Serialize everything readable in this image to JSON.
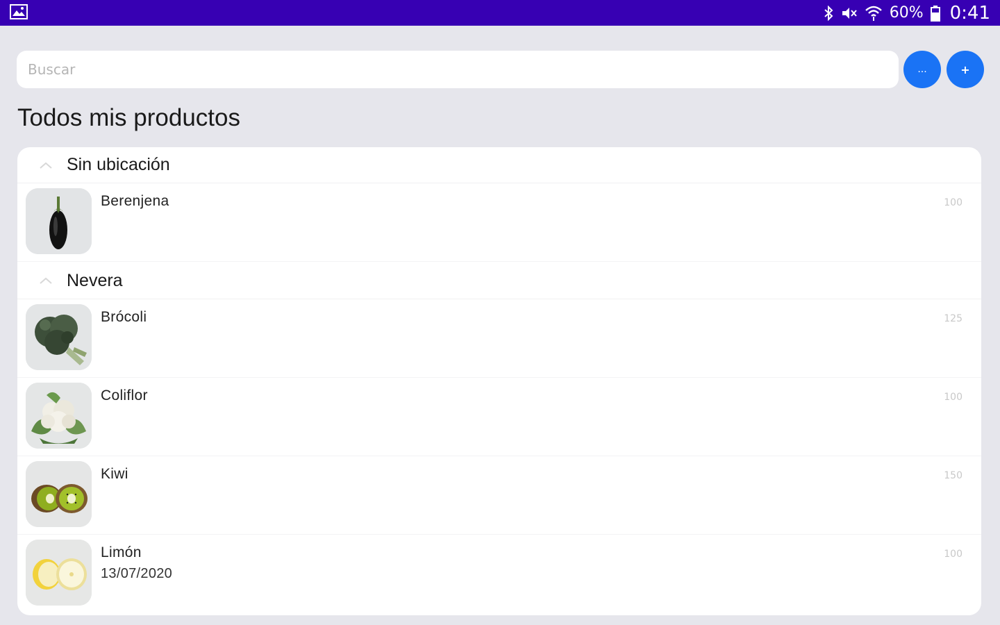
{
  "status_bar": {
    "battery": "60%",
    "time": "0:41",
    "background": "#3700b3"
  },
  "search": {
    "placeholder": "Buscar",
    "value": ""
  },
  "actions": {
    "more_label": "...",
    "add_label": "+",
    "accent": "#1a73f5"
  },
  "page": {
    "title": "Todos mis productos"
  },
  "sections": [
    {
      "label": "Sin ubicación",
      "items": [
        {
          "name": "Berenjena",
          "date": "",
          "quantity": "100",
          "icon": "eggplant-image"
        }
      ]
    },
    {
      "label": "Nevera",
      "items": [
        {
          "name": "Brócoli",
          "date": "",
          "quantity": "125",
          "icon": "broccoli-image"
        },
        {
          "name": "Coliflor",
          "date": "",
          "quantity": "100",
          "icon": "cauliflower-image"
        },
        {
          "name": "Kiwi",
          "date": "",
          "quantity": "150",
          "icon": "kiwi-image"
        },
        {
          "name": "Limón",
          "date": "13/07/2020",
          "quantity": "100",
          "icon": "lemon-image"
        }
      ]
    }
  ]
}
